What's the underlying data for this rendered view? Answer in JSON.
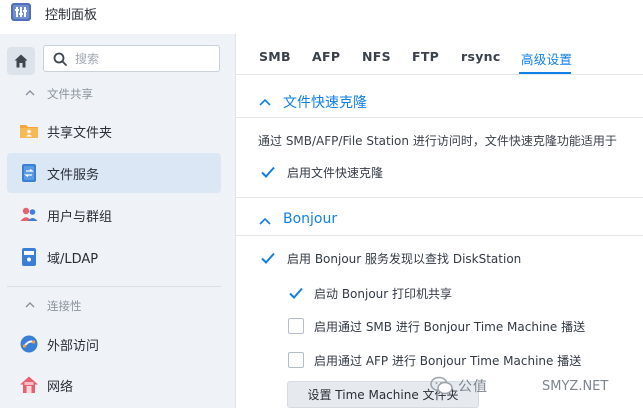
{
  "window": {
    "title": "控制面板"
  },
  "search": {
    "placeholder": "搜索"
  },
  "sidebar": {
    "sections": [
      {
        "label": "文件共享"
      },
      {
        "label": "连接性"
      }
    ],
    "items": [
      {
        "label": "共享文件夹",
        "icon": "folder-user-icon"
      },
      {
        "label": "文件服务",
        "icon": "file-services-icon",
        "active": true
      },
      {
        "label": "用户与群组",
        "icon": "users-icon"
      },
      {
        "label": "域/LDAP",
        "icon": "ldap-icon"
      },
      {
        "label": "外部访问",
        "icon": "external-access-icon"
      },
      {
        "label": "网络",
        "icon": "network-icon"
      }
    ]
  },
  "tabs": [
    {
      "label": "SMB"
    },
    {
      "label": "AFP"
    },
    {
      "label": "NFS"
    },
    {
      "label": "FTP"
    },
    {
      "label": "rsync"
    },
    {
      "label": "高级设置",
      "active": true
    }
  ],
  "sections": {
    "fast_clone": {
      "title": "文件快速克隆",
      "description": "通过 SMB/AFP/File Station 进行访问时，文件快速克隆功能适用于",
      "checkbox": {
        "label": "启用文件快速克隆",
        "checked": true
      }
    },
    "bonjour": {
      "title": "Bonjour",
      "options": [
        {
          "label": "启用 Bonjour 服务发现以查找 DiskStation",
          "checked": true
        },
        {
          "label": "启动 Bonjour 打印机共享",
          "checked": true
        },
        {
          "label": "启用通过 SMB 进行 Bonjour Time Machine 播送",
          "checked": false
        },
        {
          "label": "启用通过 AFP 进行 Bonjour Time Machine 播送",
          "checked": false
        }
      ],
      "button": "设置 Time Machine 文件夹"
    }
  },
  "watermark": {
    "text": "公值",
    "site": "SMYZ.NET"
  },
  "colors": {
    "accent": "#0f80e8",
    "sidebar_bg": "#eff2f6",
    "active_item_bg": "#dbe7f5"
  }
}
